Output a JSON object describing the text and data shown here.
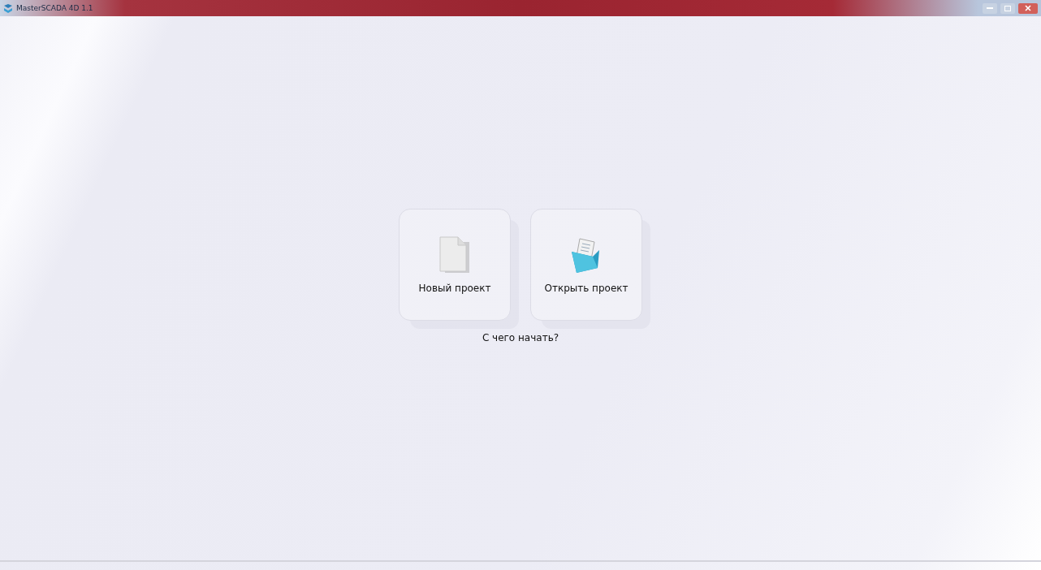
{
  "window": {
    "title": "MasterSCADA 4D 1.1"
  },
  "tiles": [
    {
      "kind": "new",
      "label": "Новый проект"
    },
    {
      "kind": "open",
      "label": "Открыть проект"
    }
  ],
  "prompt": "С чего начать?"
}
